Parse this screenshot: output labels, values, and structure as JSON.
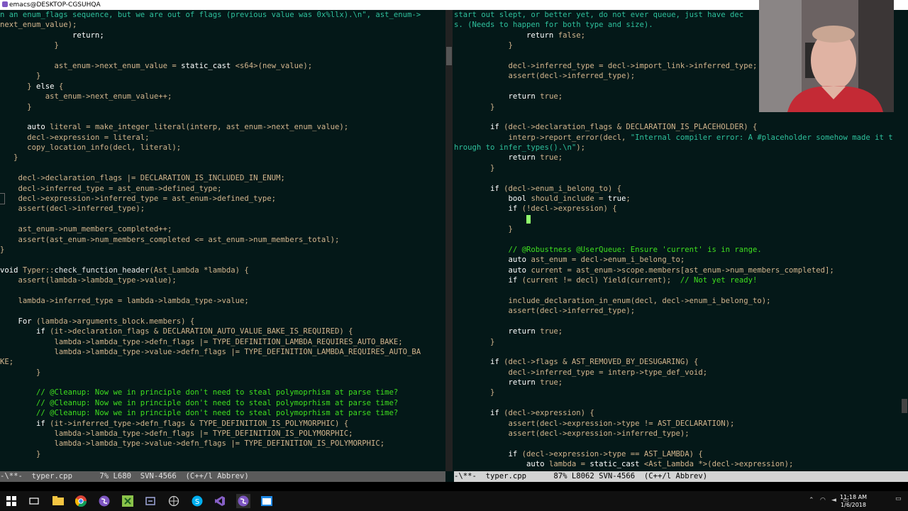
{
  "window": {
    "title": "emacs@DESKTOP-CGSUHQA"
  },
  "left_pane": {
    "lines": [
      [
        [
          "t-str",
          "n an enum_flags sequence, but we are out of flags (previous value was 0x%llx).\\n\", ast_enum->"
        ]
      ],
      [
        [
          "t-plain",
          "next_enum_value);"
        ]
      ],
      [
        [
          "t-kw",
          "                return;"
        ]
      ],
      [
        [
          "t-plain",
          "            }"
        ]
      ],
      [
        [
          "t-plain",
          ""
        ]
      ],
      [
        [
          "t-plain",
          "            ast_enum->next_enum_value = "
        ],
        [
          "t-kw",
          "static_cast"
        ],
        [
          "t-plain",
          " <s64>(new_value);"
        ]
      ],
      [
        [
          "t-plain",
          "        }"
        ]
      ],
      [
        [
          "t-plain",
          "      } "
        ],
        [
          "t-kw",
          "else"
        ],
        [
          "t-plain",
          " {"
        ]
      ],
      [
        [
          "t-plain",
          "          ast_enum->next_enum_value++;"
        ]
      ],
      [
        [
          "t-plain",
          "      }"
        ]
      ],
      [
        [
          "t-plain",
          ""
        ]
      ],
      [
        [
          "t-kw",
          "      auto"
        ],
        [
          "t-plain",
          " literal = make_integer_literal(interp, ast_enum->next_enum_value);"
        ]
      ],
      [
        [
          "t-plain",
          "      decl->expression = literal;"
        ]
      ],
      [
        [
          "t-plain",
          "      copy_location_info(decl, literal);"
        ]
      ],
      [
        [
          "t-plain",
          "   }"
        ]
      ],
      [
        [
          "t-plain",
          ""
        ]
      ],
      [
        [
          "t-plain",
          "    decl->declaration_flags |= DECLARATION_IS_INCLUDED_IN_ENUM;"
        ]
      ],
      [
        [
          "t-plain",
          "    decl->inferred_type = ast_enum->defined_type;"
        ]
      ],
      [
        [
          "t-plain",
          "    decl->expression->inferred_type = ast_enum->defined_type;"
        ]
      ],
      [
        [
          "t-plain",
          "    assert(decl->inferred_type);"
        ]
      ],
      [
        [
          "t-plain",
          ""
        ]
      ],
      [
        [
          "t-plain",
          "    ast_enum->num_members_completed++;"
        ]
      ],
      [
        [
          "t-plain",
          "    assert(ast_enum->num_members_completed <= ast_enum->num_members_total);"
        ]
      ],
      [
        [
          "t-plain",
          "}"
        ]
      ],
      [
        [
          "t-plain",
          ""
        ]
      ],
      [
        [
          "t-kw",
          "void"
        ],
        [
          "t-plain",
          " Typer::"
        ],
        [
          "t-type",
          "check_function_header"
        ],
        [
          "t-plain",
          "(Ast_Lambda *lambda) {"
        ]
      ],
      [
        [
          "t-plain",
          "    assert(lambda->lambda_type->value);"
        ]
      ],
      [
        [
          "t-plain",
          ""
        ]
      ],
      [
        [
          "t-plain",
          "    lambda->inferred_type = lambda->lambda_type->value;"
        ]
      ],
      [
        [
          "t-plain",
          ""
        ]
      ],
      [
        [
          "t-kw",
          "    For"
        ],
        [
          "t-plain",
          " (lambda->arguments_block.members) {"
        ]
      ],
      [
        [
          "t-kw",
          "        if"
        ],
        [
          "t-plain",
          " (it->declaration_flags & DECLARATION_AUTO_VALUE_BAKE_IS_REQUIRED) {"
        ]
      ],
      [
        [
          "t-plain",
          "            lambda->lambda_type->defn_flags |= TYPE_DEFINITION_LAMBDA_REQUIRES_AUTO_BAKE;"
        ]
      ],
      [
        [
          "t-plain",
          "            lambda->lambda_type->value->defn_flags |= TYPE_DEFINITION_LAMBDA_REQUIRES_AUTO_BA"
        ]
      ],
      [
        [
          "t-plain",
          "KE;"
        ]
      ],
      [
        [
          "t-plain",
          "        }"
        ]
      ],
      [
        [
          "t-plain",
          ""
        ]
      ],
      [
        [
          "t-cmt",
          "        // @Cleanup: Now we in principle don't need to steal polymoprhism at parse time?"
        ]
      ],
      [
        [
          "t-cmt",
          "        // @Cleanup: Now we in principle don't need to steal polymoprhism at parse time?"
        ]
      ],
      [
        [
          "t-cmt",
          "        // @Cleanup: Now we in principle don't need to steal polymoprhism at parse time?"
        ]
      ],
      [
        [
          "t-kw",
          "        if"
        ],
        [
          "t-plain",
          " (it->inferred_type->defn_flags & TYPE_DEFINITION_IS_POLYMORPHIC) {"
        ]
      ],
      [
        [
          "t-plain",
          "            lambda->lambda_type->defn_flags |= TYPE_DEFINITION_IS_POLYMORPHIC;"
        ]
      ],
      [
        [
          "t-plain",
          "            lambda->lambda_type->value->defn_flags |= TYPE_DEFINITION_IS_POLYMORPHIC;"
        ]
      ],
      [
        [
          "t-plain",
          "        }"
        ]
      ],
      [
        [
          "t-plain",
          ""
        ]
      ]
    ]
  },
  "right_pane": {
    "lines": [
      [
        [
          "t-str",
          "start out slept, or better yet, do not ever queue, just have dec"
        ]
      ],
      [
        [
          "t-str",
          "s. (Needs to happen for both type and size)."
        ]
      ],
      [
        [
          "t-kw",
          "                return"
        ],
        [
          "t-plain",
          " false;"
        ]
      ],
      [
        [
          "t-plain",
          "            }"
        ]
      ],
      [
        [
          "t-plain",
          ""
        ]
      ],
      [
        [
          "t-plain",
          "            decl->inferred_type = decl->import_link->inferred_type;"
        ]
      ],
      [
        [
          "t-plain",
          "            assert(decl->inferred_type);"
        ]
      ],
      [
        [
          "t-plain",
          ""
        ]
      ],
      [
        [
          "t-kw",
          "            return"
        ],
        [
          "t-plain",
          " true;"
        ]
      ],
      [
        [
          "t-plain",
          "        }"
        ]
      ],
      [
        [
          "t-plain",
          ""
        ]
      ],
      [
        [
          "t-kw",
          "        if"
        ],
        [
          "t-plain",
          " (decl->declaration_flags & DECLARATION_IS_PLACEHOLDER) {"
        ]
      ],
      [
        [
          "t-plain",
          "            interp->report_error(decl, "
        ],
        [
          "t-str",
          "\"Internal compiler error: A #placeholder somehow made it t"
        ]
      ],
      [
        [
          "t-str",
          "hrough to infer_types().\\n\""
        ],
        [
          "t-plain",
          ");"
        ]
      ],
      [
        [
          "t-kw",
          "            return"
        ],
        [
          "t-plain",
          " true;"
        ]
      ],
      [
        [
          "t-plain",
          "        }"
        ]
      ],
      [
        [
          "t-plain",
          ""
        ]
      ],
      [
        [
          "t-kw",
          "        if"
        ],
        [
          "t-plain",
          " (decl->enum_i_belong_to) {"
        ]
      ],
      [
        [
          "t-kw",
          "            bool"
        ],
        [
          "t-plain",
          " should_include = "
        ],
        [
          "t-kw",
          "true"
        ],
        [
          "t-plain",
          ";"
        ]
      ],
      [
        [
          "t-kw",
          "            if"
        ],
        [
          "t-plain",
          " (!decl->expression) {"
        ]
      ],
      [
        [
          "t-plain",
          "                "
        ],
        [
          "t-cursor",
          "X"
        ]
      ],
      [
        [
          "t-plain",
          "            }"
        ]
      ],
      [
        [
          "t-plain",
          ""
        ]
      ],
      [
        [
          "t-cmt",
          "            // @Robustness @UserQueue: Ensure 'current' is in range."
        ]
      ],
      [
        [
          "t-kw",
          "            auto"
        ],
        [
          "t-plain",
          " ast_enum = decl->enum_i_belong_to;"
        ]
      ],
      [
        [
          "t-kw",
          "            auto"
        ],
        [
          "t-plain",
          " current = ast_enum->scope.members[ast_enum->num_members_completed];"
        ]
      ],
      [
        [
          "t-kw",
          "            if"
        ],
        [
          "t-plain",
          " (current != decl) Yield(current);  "
        ],
        [
          "t-cmt",
          "// Not yet ready!"
        ]
      ],
      [
        [
          "t-plain",
          ""
        ]
      ],
      [
        [
          "t-plain",
          "            include_declaration_in_enum(decl, decl->enum_i_belong_to);"
        ]
      ],
      [
        [
          "t-plain",
          "            assert(decl->inferred_type);"
        ]
      ],
      [
        [
          "t-plain",
          ""
        ]
      ],
      [
        [
          "t-kw",
          "            return"
        ],
        [
          "t-plain",
          " true;"
        ]
      ],
      [
        [
          "t-plain",
          "        }"
        ]
      ],
      [
        [
          "t-plain",
          ""
        ]
      ],
      [
        [
          "t-kw",
          "        if"
        ],
        [
          "t-plain",
          " (decl->flags & AST_REMOVED_BY_DESUGARING) {"
        ]
      ],
      [
        [
          "t-plain",
          "            decl->inferred_type = interp->type_def_void;"
        ]
      ],
      [
        [
          "t-kw",
          "            return"
        ],
        [
          "t-plain",
          " true;"
        ]
      ],
      [
        [
          "t-plain",
          "        }"
        ]
      ],
      [
        [
          "t-plain",
          ""
        ]
      ],
      [
        [
          "t-kw",
          "        if"
        ],
        [
          "t-plain",
          " (decl->expression) {"
        ]
      ],
      [
        [
          "t-plain",
          "            assert(decl->expression->type != AST_DECLARATION);"
        ]
      ],
      [
        [
          "t-plain",
          "            assert(decl->expression->inferred_type);"
        ]
      ],
      [
        [
          "t-plain",
          ""
        ]
      ],
      [
        [
          "t-kw",
          "            if"
        ],
        [
          "t-plain",
          " (decl->expression->type == AST_LAMBDA) {"
        ]
      ],
      [
        [
          "t-kw",
          "                auto"
        ],
        [
          "t-plain",
          " lambda = "
        ],
        [
          "t-kw",
          "static_cast"
        ],
        [
          "t-plain",
          " <Ast_Lambda *>(decl->expression);"
        ]
      ]
    ]
  },
  "modeline_left": {
    "text": "-\\**-  typer.cpp      7% L680  SVN-4566  (C++/l Abbrev)"
  },
  "modeline_right": {
    "text": "-\\**-  typer.cpp      87% L8062 SVN-4566  (C++/l Abbrev)"
  },
  "taskbar": {
    "time": "11:18 AM",
    "date": "1/6/2018",
    "icons": [
      "windows-start-icon",
      "task-view-icon",
      "file-explorer-icon",
      "chrome-icon",
      "emacs-icon",
      "cheat-icon",
      "settings-icon",
      "network-icon",
      "skype-icon",
      "visual-studio-icon",
      "emacs-active-icon",
      "terminal-icon"
    ]
  }
}
